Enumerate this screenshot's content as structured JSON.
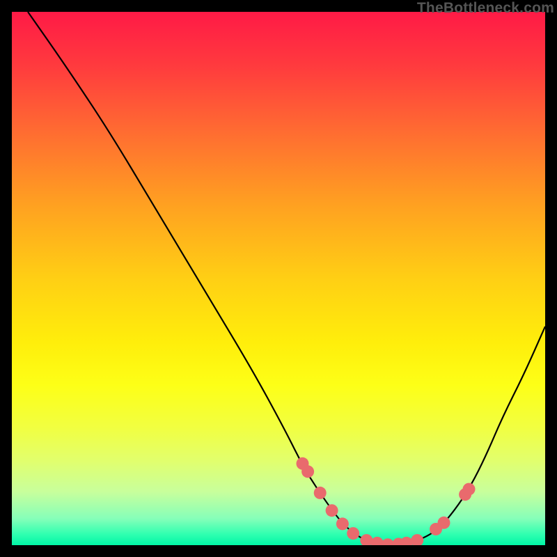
{
  "watermark": "TheBottleneck.com",
  "chart_data": {
    "type": "line",
    "title": "",
    "xlabel": "",
    "ylabel": "",
    "xlim": [
      0,
      100
    ],
    "ylim": [
      0,
      100
    ],
    "grid": false,
    "series": [
      {
        "name": "bottleneck-curve",
        "x": [
          3,
          10,
          18,
          27,
          36,
          45,
          51,
          55,
          59,
          62,
          65,
          68,
          71,
          74,
          77,
          80,
          83,
          86,
          89,
          92,
          96,
          100
        ],
        "y": [
          100,
          90,
          78,
          63,
          48,
          33,
          22,
          14,
          8,
          4,
          1.5,
          0.4,
          0,
          0.3,
          1.2,
          3,
          6.5,
          11,
          17,
          24,
          32,
          41
        ]
      }
    ],
    "points": {
      "name": "sampled-points",
      "x": [
        54.5,
        55.5,
        57.8,
        60.0,
        62.0,
        64.0,
        66.5,
        68.5,
        70.5,
        72.5,
        74.0,
        76.0,
        79.5,
        81.0,
        85.0,
        85.7
      ],
      "y": [
        15.3,
        13.8,
        9.8,
        6.5,
        4.0,
        2.2,
        0.9,
        0.4,
        0.1,
        0.2,
        0.4,
        0.9,
        3.0,
        4.2,
        9.5,
        10.5
      ]
    },
    "colors": {
      "curve": "#000000",
      "points": "#e96a6d",
      "gradient_top": "#ff1a46",
      "gradient_bottom": "#00f5a6"
    }
  }
}
